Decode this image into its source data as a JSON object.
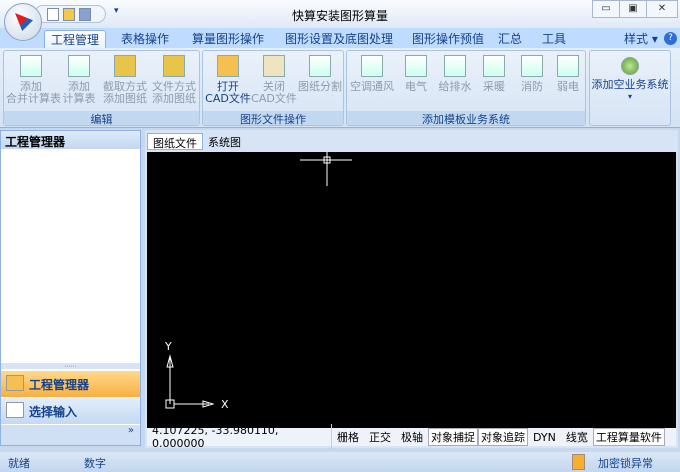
{
  "window": {
    "title": "快算安装图形算量",
    "min": "▭",
    "max": "▣",
    "close": "✕"
  },
  "tabs": [
    "工程管理",
    "表格操作",
    "算量图形操作",
    "图形设置及底图处理",
    "图形操作预值",
    "汇总",
    "工具"
  ],
  "style_label": "样式",
  "help": "?",
  "ribbon": {
    "groups": [
      {
        "label": "编辑",
        "buttons": [
          "添加\n合并计算表",
          "添加\n计算表",
          "截取方式\n添加图纸",
          "文件方式\n添加图纸"
        ]
      },
      {
        "label": "图形文件操作",
        "buttons": [
          "打开\nCAD文件",
          "关闭\nCAD文件",
          "图纸分割"
        ]
      },
      {
        "label": "添加模板业务系统",
        "buttons": [
          "空调通风",
          "电气",
          "给排水",
          "采暖",
          "消防",
          "弱电"
        ]
      },
      {
        "label": "",
        "buttons": [
          "添加空业务系统"
        ]
      }
    ]
  },
  "left_panel": {
    "title": "工程管理器",
    "nav": [
      "工程管理器",
      "选择输入"
    ],
    "more": "»"
  },
  "canvas": {
    "tabs": [
      "图纸文件",
      "系统图"
    ],
    "axis_x": "X",
    "axis_y": "Y",
    "status": {
      "coords": "4.107225,  -33.980110,  0.000000",
      "items": [
        "栅格",
        "正交",
        "极轴",
        "对象捕捉",
        "对象追踪",
        "DYN",
        "线宽",
        "工程算量软件"
      ]
    }
  },
  "statusbar": {
    "ready": "就绪",
    "num": "数字",
    "lock": "加密锁异常"
  }
}
